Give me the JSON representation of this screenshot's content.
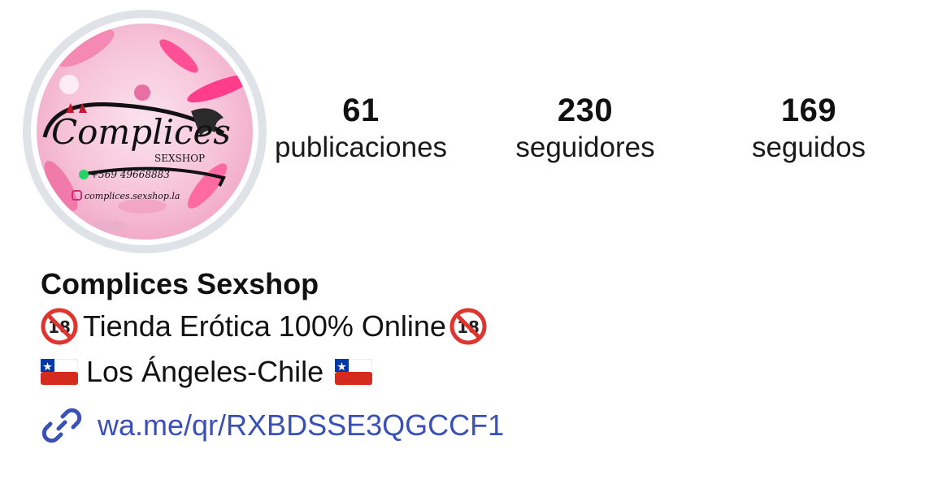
{
  "avatar": {
    "brand": "Complices",
    "sub": "SEXSHOP",
    "phone": "+569 49668883",
    "handle": "complices.sexshop.la"
  },
  "stats": [
    {
      "value": "61",
      "label": "publicaciones"
    },
    {
      "value": "230",
      "label": "seguidores"
    },
    {
      "value": "169",
      "label": "seguidos"
    }
  ],
  "profile": {
    "name": "Complices Sexshop",
    "bio_line1": "Tienda Erótica 100% Online",
    "bio_line2": "Los Ángeles-Chile",
    "link": "wa.me/qr/RXBDSSE3QGCCF1"
  },
  "colors": {
    "link": "#3a50b8",
    "avatar_ring": "#dfe2e7",
    "avatar_bg": "#f6c6d8"
  },
  "icons": [
    "no-under-18-emoji",
    "chile-flag-emoji",
    "link-icon",
    "whatsapp-icon",
    "instagram-icon"
  ]
}
